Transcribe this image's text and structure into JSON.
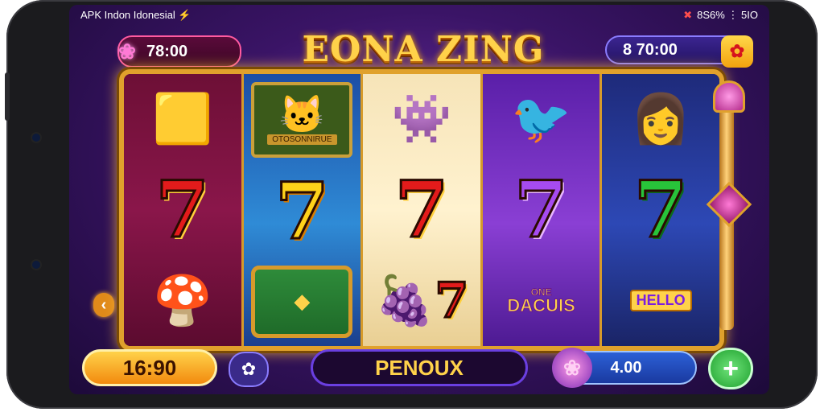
{
  "status": {
    "carrier": "APK Indon Idonesial ⚡",
    "indicators": "8S6% ⋮ 5IO"
  },
  "game": {
    "title": "EONA ZING"
  },
  "balance_left": {
    "value": "78:00",
    "icon": "gem-icon"
  },
  "balance_right": {
    "value": "8 70:00",
    "icon": "gift-icon"
  },
  "reels": {
    "tile_caption": "OTOSONNIRUE",
    "lucky_line1": "ONE",
    "lucky_line2": "DACUIS",
    "hello": "HELLO"
  },
  "bottom": {
    "bet_value": "16:90",
    "bonus_label": "PENOUX",
    "win_value": "4.00",
    "plus_label": "+"
  },
  "colors": {
    "accent_gold": "#ffd24a",
    "frame_gold": "#e0a12c",
    "purple_bg": "#3a1466"
  }
}
